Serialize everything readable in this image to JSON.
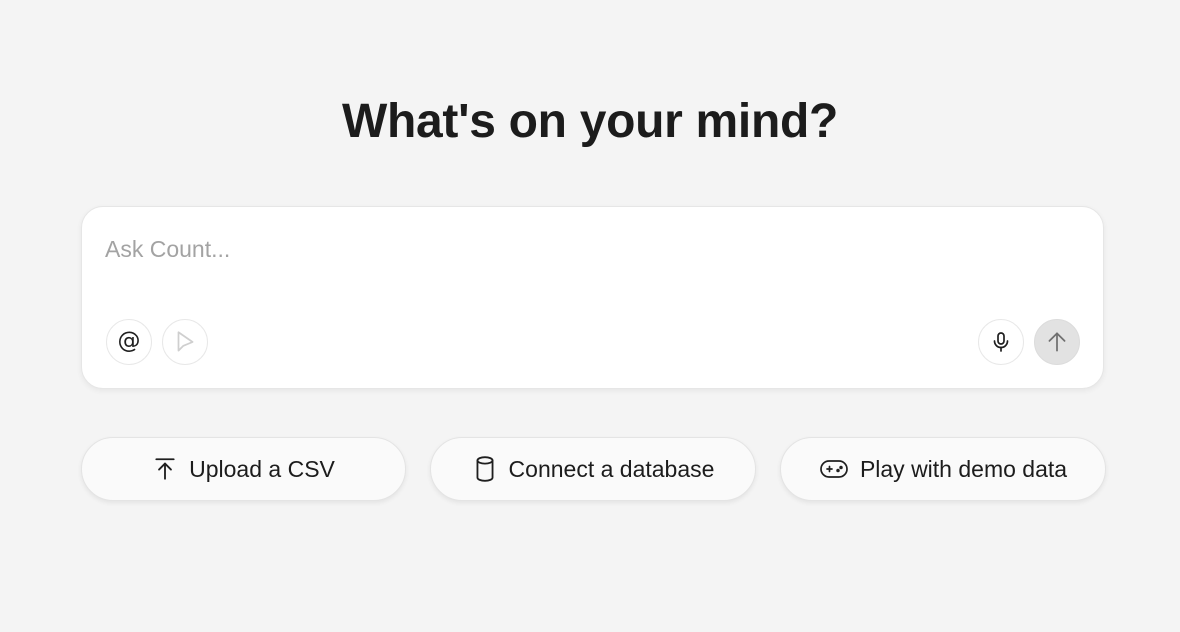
{
  "headline": "What's on your mind?",
  "composer": {
    "placeholder": "Ask Count...",
    "value": "",
    "mention_glyph": "@",
    "icons": {
      "mention": "at-sign-icon",
      "pointer": "cursor-pointer-icon",
      "mic": "microphone-icon",
      "send": "arrow-up-icon"
    }
  },
  "actions": [
    {
      "label": "Upload a CSV",
      "icon": "upload-icon"
    },
    {
      "label": "Connect a database",
      "icon": "database-icon"
    },
    {
      "label": "Play with demo data",
      "icon": "gamepad-icon"
    }
  ],
  "colors": {
    "background": "#f4f4f4",
    "card": "#ffffff",
    "send_button": "#e2e2e2",
    "placeholder_text": "#a3a3a3",
    "text": "#1c1c1c"
  }
}
